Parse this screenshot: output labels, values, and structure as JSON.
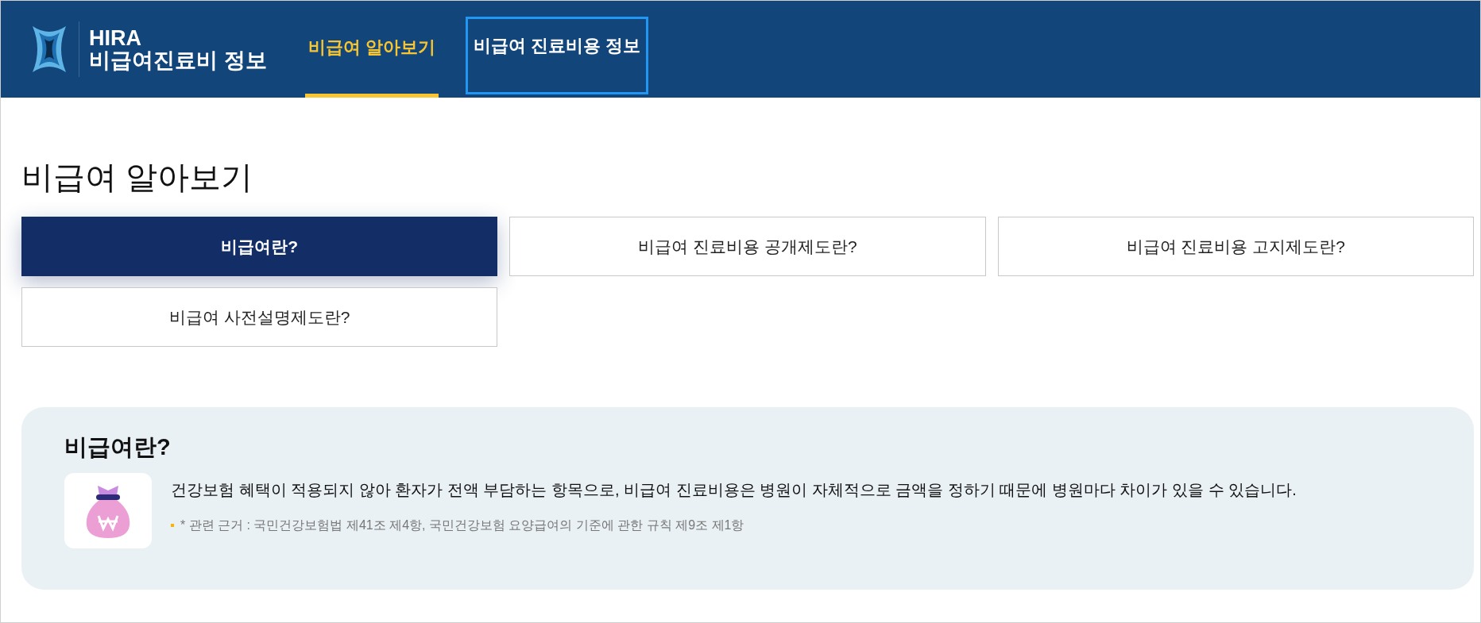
{
  "logo": {
    "line1": "HIRA",
    "line2": "비급여진료비 정보"
  },
  "nav": [
    {
      "label": "비급여 알아보기",
      "selected": true,
      "focused": false
    },
    {
      "label": "비급여 진료비용 정보",
      "selected": false,
      "focused": true
    }
  ],
  "page_title": "비급여 알아보기",
  "topics": [
    {
      "label": "비급여란?",
      "selected": true
    },
    {
      "label": "비급여 진료비용 공개제도란?",
      "selected": false
    },
    {
      "label": "비급여 진료비용 고지제도란?",
      "selected": false
    },
    {
      "label": "비급여 사전설명제도란?",
      "selected": false
    }
  ],
  "info": {
    "title": "비급여란?",
    "description": "건강보험 혜택이 적용되지 않아 환자가 전액 부담하는 항목으로, 비급여 진료비용은 병원이 자체적으로 금액을 정하기 때문에 병원마다 차이가 있을 수 있습니다.",
    "note": "* 관련 근거 : 국민건강보험법 제41조 제4항, 국민건강보험 요양급여의 기준에 관한 규칙 제9조 제1항"
  }
}
